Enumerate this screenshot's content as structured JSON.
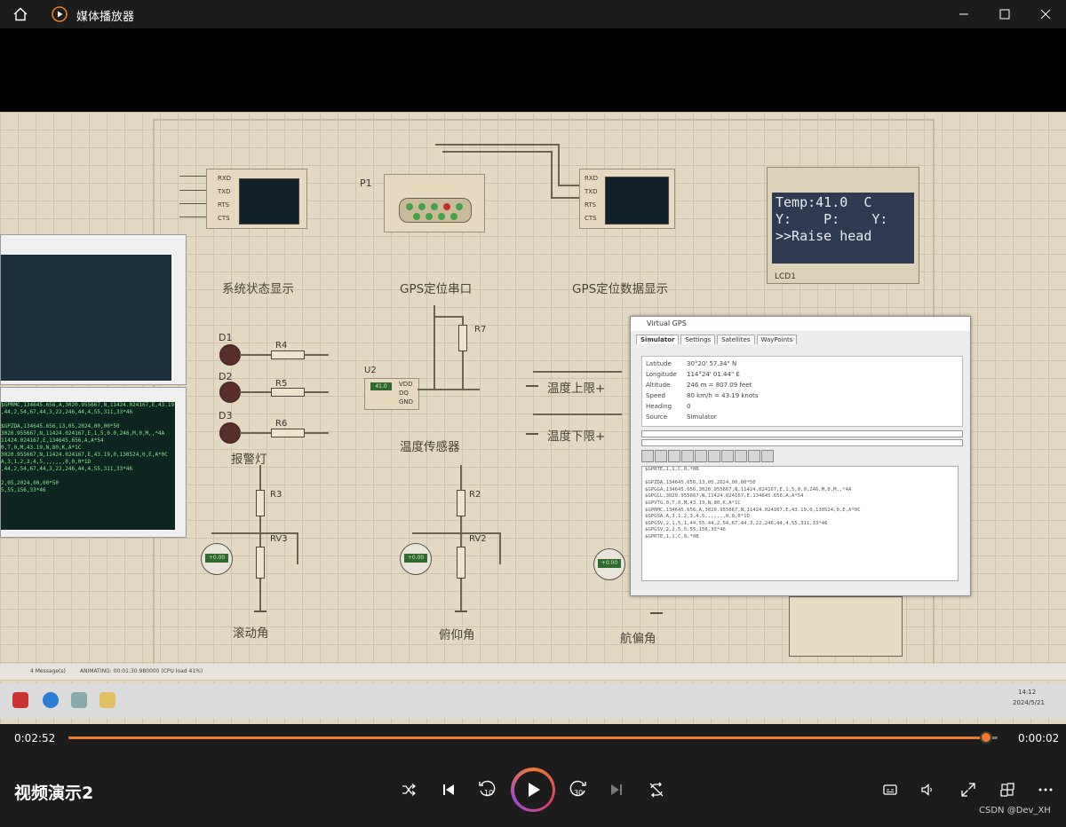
{
  "window": {
    "title": "媒体播放器",
    "icons": {
      "home": "home-icon",
      "app": "media-player-icon",
      "minimize": "minimize-icon",
      "maximize": "maximize-icon",
      "close": "close-icon"
    }
  },
  "schematic": {
    "captions": {
      "system_status": "系统状态显示",
      "gps_serial": "GPS定位串口",
      "gps_data": "GPS定位数据显示",
      "alarm_light": "报警灯",
      "temp_sensor": "温度传感器",
      "temp_upper": "温度上限+",
      "temp_lower": "温度下限+",
      "roll": "滚动角",
      "pitch": "俯仰角",
      "yaw": "航偏角"
    },
    "labels": {
      "p1": "P1",
      "u2": "U2",
      "d1": "D1",
      "d2": "D2",
      "d3": "D3",
      "r4": "R4",
      "r5": "R5",
      "r6": "R6",
      "r7": "R7",
      "r3": "R3",
      "r2": "R2",
      "rv3": "RV3",
      "rv2": "RV2",
      "lcd1": "LCD1",
      "pins_left": [
        "RXD",
        "TXD",
        "RTS",
        "CTS"
      ],
      "pins_right": [
        "RXD",
        "TXD",
        "RTS",
        "CTS"
      ],
      "u2_pins": [
        "VDD",
        "DQ",
        "GND"
      ],
      "ds_value": "41.0",
      "meter_values": [
        "+0.00",
        "+0.00",
        "+0.00"
      ]
    },
    "lcd": {
      "line1": "Temp:41.0  C",
      "line2": "Y:    P:    Y:",
      "line3": ">>Raise head"
    }
  },
  "virtual_gps": {
    "title": "Virtual GPS",
    "tabs": [
      "Simulator",
      "Settings",
      "Satellites",
      "WayPoints"
    ],
    "active_tab": "Simulator",
    "info": [
      {
        "k": "Latitude",
        "v": "30°20' 57.34\" N"
      },
      {
        "k": "Longitude",
        "v": "114°24' 01.44\" E"
      },
      {
        "k": "Altitude",
        "v": "246 m = 807.09 feet"
      },
      {
        "k": "Speed",
        "v": "80 km/h = 43.19 knots"
      },
      {
        "k": "Heading",
        "v": "0"
      },
      {
        "k": "Source",
        "v": "Simulator"
      }
    ],
    "log": [
      "$GPRTE,1,1,C,0,*0B",
      "",
      "$GPZDA,134645.656,13,05,2024,00,00*50",
      "$GPGGA,134645.656,3020.955667,N,11424.024167,E,1,5,0.0,246,M,0,M,,*4A",
      "$GPGLL,3020.955667,N,11424.024167,E,134645.656,A,A*54",
      "$GPVTG,0,T,0,M,43.19,N,80,K,A*1C",
      "$GPRMC,134645.656,A,3020.955667,N,11424.024167,E,43.19,0,130524,0,E,A*0C",
      "$GPGSA,A,3,1,2,3,4,5,,,,,,,0,0,0*1D",
      "$GPGSV,2,1,5,1,44,55,44,2,54,67,44,3,22,246,44,4,55,311,33*46",
      "$GPGSV,2,2,5,5,55,156,33*46",
      "$GPRTE,1,1,C,0,*0B"
    ]
  },
  "terminal_lines": [
    "$GPRMC,134645.656,A,3020.955667,N,11424.024167,E,43.19",
    ",44,2,54,67,44,3,22,246,44,4,55,311,33*46",
    "",
    "$GPZDA,134645.656,13,05,2024,00,00*50",
    "3020.955667,N,11424.024167,E,1,5,0.0,246,M,0,M,,*4A",
    "11424.024167,E,134645.656,A,A*54",
    "0,T,0,M,43.19,N,80,K,A*1C",
    "3020.955667,N,11424.024167,E,43.19,0,130524,0,E,A*0C",
    "A,3,1,2,3,4,5,,,,,,,0,0,0*1D",
    ",44,2,54,67,44,3,22,246,44,4,55,311,33*46",
    "",
    "2,05,2024,00,00*50",
    "5,55,156,33*46"
  ],
  "status": {
    "messages": "4 Message(s)",
    "animating": "ANIMATING: 00:01:30.980000 (CPU load 41%)"
  },
  "tray": {
    "time": "14:12",
    "date": "2024/5/21"
  },
  "player": {
    "elapsed": "0:02:52",
    "remaining": "0:00:02",
    "progress": 0.988,
    "video_title": "视频演示2",
    "watermark": "CSDN @Dev_XH",
    "accent": "#f07a2a",
    "buttons": {
      "shuffle": "shuffle-icon",
      "previous": "previous-icon",
      "rewind": "rewind-10-icon",
      "rewind_label": "10",
      "play": "play-icon",
      "forward": "forward-30-icon",
      "forward_label": "30",
      "next": "next-icon",
      "repeat": "repeat-off-icon",
      "subtitles": "subtitles-icon",
      "volume": "volume-icon",
      "fullscreen": "fullscreen-icon",
      "miniplayer": "miniplayer-icon",
      "more": "more-icon"
    }
  }
}
